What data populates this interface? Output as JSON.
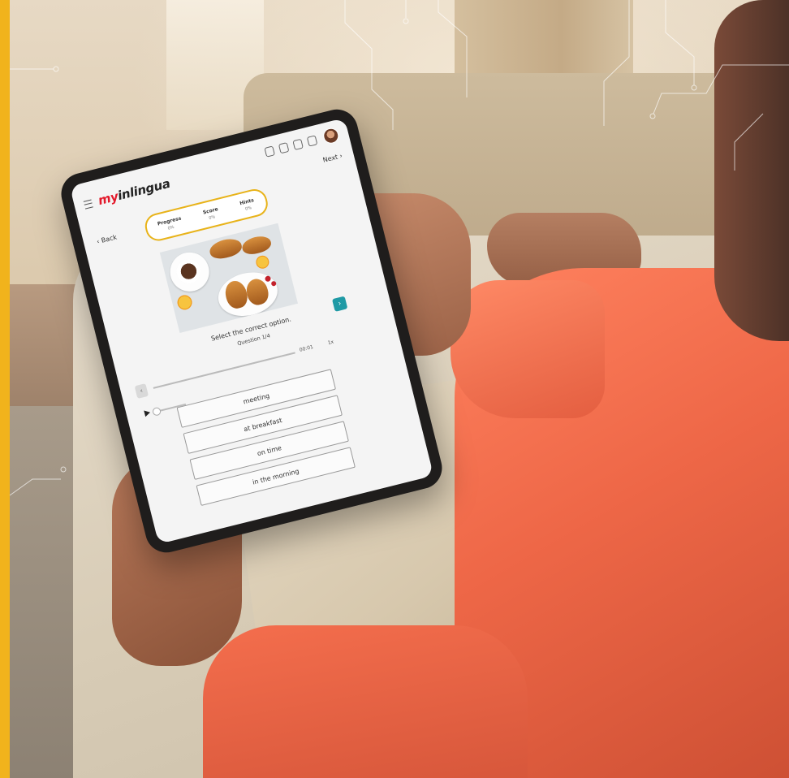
{
  "app": {
    "logo_prefix": "my",
    "logo_brand": "inlingua"
  },
  "nav": {
    "back_label": "Back",
    "next_label": "Next"
  },
  "stats": [
    {
      "label": "Progress",
      "value": "0%"
    },
    {
      "label": "Score",
      "value": "0%"
    },
    {
      "label": "Hints",
      "value": "0%"
    }
  ],
  "exercise": {
    "instruction": "Select the correct option.",
    "question_counter": "Question 1/4",
    "audio_time": "00:01",
    "audio_speed": "1x",
    "options": [
      "meeting",
      "at breakfast",
      "on time",
      "in the morning"
    ]
  },
  "colors": {
    "accent_yellow": "#f1b31c",
    "brand_red": "#e3192b",
    "button_teal": "#1f9aa5",
    "sweater_orange": "#ee6747"
  },
  "icons": [
    "menu-icon",
    "phone-icon",
    "bell-icon",
    "chat-icon",
    "user-icon",
    "avatar",
    "chevron-left-icon",
    "chevron-right-icon",
    "play-icon"
  ]
}
